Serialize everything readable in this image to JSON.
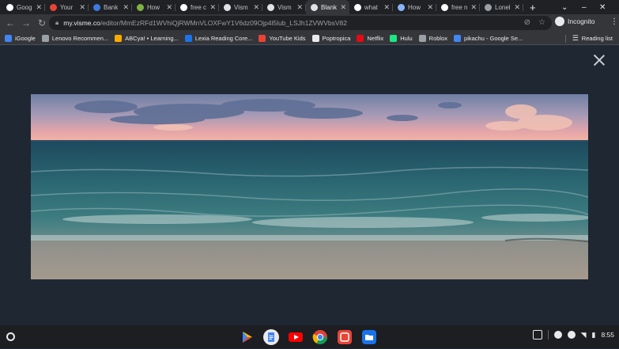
{
  "tabs": [
    {
      "title": "Goog",
      "favicon": "google-icon",
      "color": "#ffffff",
      "active": false
    },
    {
      "title": "Your",
      "favicon": "gmail-icon",
      "color": "#ea4335",
      "active": false
    },
    {
      "title": "Bank",
      "favicon": "wix-icon",
      "color": "#3b7be0",
      "active": false
    },
    {
      "title": "How",
      "favicon": "pear-icon",
      "color": "#7cb342",
      "active": false
    },
    {
      "title": "free c",
      "favicon": "google-icon",
      "color": "#ffffff",
      "active": false
    },
    {
      "title": "Vism",
      "favicon": "visme-icon",
      "color": "#dfe3e8",
      "active": false
    },
    {
      "title": "Vism",
      "favicon": "visme-icon",
      "color": "#dfe3e8",
      "active": false
    },
    {
      "title": "Blank",
      "favicon": "visme-icon",
      "color": "#dfe3e8",
      "active": true
    },
    {
      "title": "what",
      "favicon": "google-icon",
      "color": "#ffffff",
      "active": false
    },
    {
      "title": "How",
      "favicon": "web-icon",
      "color": "#8ab4f8",
      "active": false
    },
    {
      "title": "free n",
      "favicon": "google-icon",
      "color": "#ffffff",
      "active": false
    },
    {
      "title": "Lonel",
      "favicon": "globe-icon",
      "color": "#9aa0a6",
      "active": false
    }
  ],
  "toolbar": {
    "url_host": "my.visme.co",
    "url_path": "/editor/MmEzRFd1WVhiQjRWMnVLOXFwY1V6dz09Ojp4l5lub_LSJh1ZVWVbsV82",
    "incognito_label": "Incognito"
  },
  "bookmarks": [
    {
      "label": "iGoogle",
      "icon": "google-icon",
      "color": "#4285f4"
    },
    {
      "label": "Lenovo Recommen...",
      "icon": "folder-icon",
      "color": "#9aa0a6"
    },
    {
      "label": "ABCya! • Learning...",
      "icon": "abcya-icon",
      "color": "#f9ab00"
    },
    {
      "label": "Lexia Reading Core...",
      "icon": "lexia-icon",
      "color": "#1a73e8"
    },
    {
      "label": "YouTube Kids",
      "icon": "youtube-kids-icon",
      "color": "#ea4335"
    },
    {
      "label": "Poptropica",
      "icon": "poptropica-icon",
      "color": "#e8eaed"
    },
    {
      "label": "Netflix",
      "icon": "netflix-icon",
      "color": "#e50914"
    },
    {
      "label": "Hulu",
      "icon": "hulu-icon",
      "color": "#1ce783"
    },
    {
      "label": "Roblox",
      "icon": "folder-icon",
      "color": "#9aa0a6"
    },
    {
      "label": "pikachu - Google Se...",
      "icon": "google-icon",
      "color": "#4285f4"
    }
  ],
  "reading_list_label": "Reading list",
  "clock": "8:55"
}
